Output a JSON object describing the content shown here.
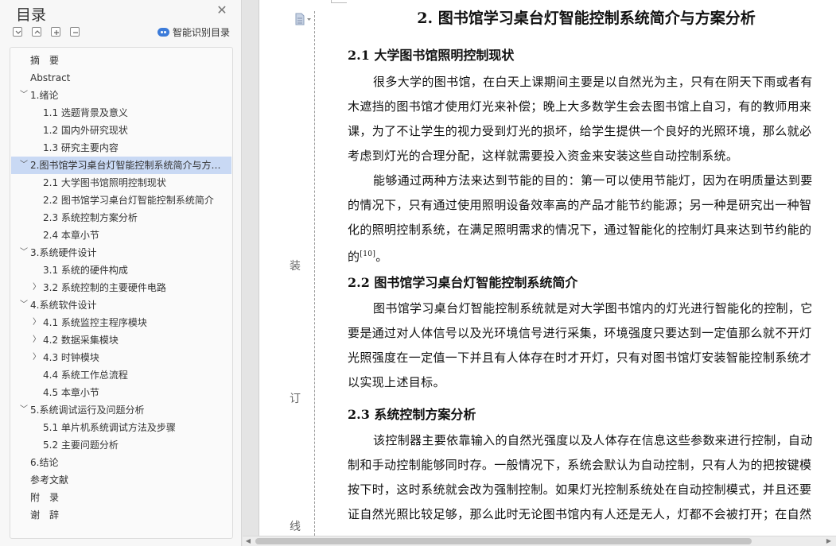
{
  "nav": {
    "title": "目录",
    "smart_toc_label": "智能识别目录",
    "tools": [
      "collapse-all-icon",
      "expand-all-icon",
      "add-heading-icon",
      "remove-heading-icon"
    ],
    "items": [
      {
        "label": "摘　要",
        "level": 1,
        "chevron": ""
      },
      {
        "label": "Abstract",
        "level": 1,
        "chevron": ""
      },
      {
        "label": "1.绪论",
        "level": 1,
        "chevron": "down"
      },
      {
        "label": "1.1  选题背景及意义",
        "level": 2,
        "chevron": ""
      },
      {
        "label": "1.2  国内外研究现状",
        "level": 2,
        "chevron": ""
      },
      {
        "label": "1.3  研究主要内容",
        "level": 2,
        "chevron": ""
      },
      {
        "label": "2.图书馆学习桌台灯智能控制系统简介与方案分析",
        "level": 1,
        "chevron": "down",
        "active": true
      },
      {
        "label": "2.1  大学图书馆照明控制现状",
        "level": 2,
        "chevron": ""
      },
      {
        "label": "2.2  图书馆学习桌台灯智能控制系统简介",
        "level": 2,
        "chevron": ""
      },
      {
        "label": "2.3  系统控制方案分析",
        "level": 2,
        "chevron": ""
      },
      {
        "label": "2.4  本章小节",
        "level": 2,
        "chevron": ""
      },
      {
        "label": "3.系统硬件设计",
        "level": 1,
        "chevron": "down"
      },
      {
        "label": "3.1  系统的硬件构成",
        "level": 2,
        "chevron": ""
      },
      {
        "label": "3.2  系统控制的主要硬件电路",
        "level": 2,
        "chevron": "right"
      },
      {
        "label": "4.系统软件设计",
        "level": 1,
        "chevron": "down"
      },
      {
        "label": "4.1 系统监控主程序模块",
        "level": 2,
        "chevron": "right"
      },
      {
        "label": "4.2  数据采集模块",
        "level": 2,
        "chevron": "right"
      },
      {
        "label": "4.3  时钟模块",
        "level": 2,
        "chevron": "right"
      },
      {
        "label": "4.4  系统工作总流程",
        "level": 2,
        "chevron": ""
      },
      {
        "label": "4.5  本章小节",
        "level": 2,
        "chevron": ""
      },
      {
        "label": "5.系统调试运行及问题分析",
        "level": 1,
        "chevron": "down"
      },
      {
        "label": "5.1  单片机系统调试方法及步骤",
        "level": 2,
        "chevron": ""
      },
      {
        "label": "5.2  主要问题分析",
        "level": 2,
        "chevron": ""
      },
      {
        "label": "6.结论",
        "level": 1,
        "chevron": ""
      },
      {
        "label": "参考文献",
        "level": 1,
        "chevron": ""
      },
      {
        "label": "附　录",
        "level": 1,
        "chevron": ""
      },
      {
        "label": "谢　辞",
        "level": 1,
        "chevron": ""
      }
    ]
  },
  "binding_chars": [
    "装",
    "订",
    "线"
  ],
  "document": {
    "h1": "2.  图书馆学习桌台灯智能控制系统简介与方案分析",
    "s21_title": "2.1  大学图书馆照明控制现状",
    "p1": [
      "很多大学的图书馆，在白天上课期间主要是以自然光为主，只有在阴天下雨或者有",
      "木遮挡的图书馆才使用灯光来补偿；晚上大多数学生会去图书馆上自习，有的教师用来",
      "课，为了不让学生的视力受到灯光的损坏，给学生提供一个良好的光照环境，那么就必",
      "考虑到灯光的合理分配，这样就需要投入资金来安装这些自动控制系统。"
    ],
    "p2": [
      "能够通过两种方法来达到节能的目的：第一可以使用节能灯，因为在明质量达到要",
      "的情况下，只有通过使用照明设备效率高的产品才能节约能源；另一种是研究出一种智",
      "化的照明控制系统，在满足照明需求的情况下，通过智能化的控制灯具来达到节约能的",
      "的"
    ],
    "p2_citation": "[10]",
    "p2_end": "。",
    "s22_title": "2.2  图书馆学习桌台灯智能控制系统简介",
    "p3": [
      "图书馆学习桌台灯智能控制系统就是对大学图书馆内的灯光进行智能化的控制，它",
      "要是通过对人体信号以及光环境信号进行采集，环境强度只要达到一定值那么就不开灯",
      "光照强度在一定值一下并且有人体存在时才开灯，只有对图书馆灯安装智能控制系统才",
      "以实现上述目标。"
    ],
    "s23_title": "2.3  系统控制方案分析",
    "p4": [
      "该控制器主要依靠输入的自然光强度以及人体存在信息这些参数来进行控制，自动",
      "制和手动控制能够同时存。一般情况下，系统会默认为自动控制，只有人为的把按键模",
      "按下时，这时系统就会改为强制控制。如果灯光控制系统处在自动控制模式，并且还要",
      "证自然光照比较足够，那么此时无论图书馆内有人还是无人，灯都不会被打开；在自然"
    ]
  }
}
